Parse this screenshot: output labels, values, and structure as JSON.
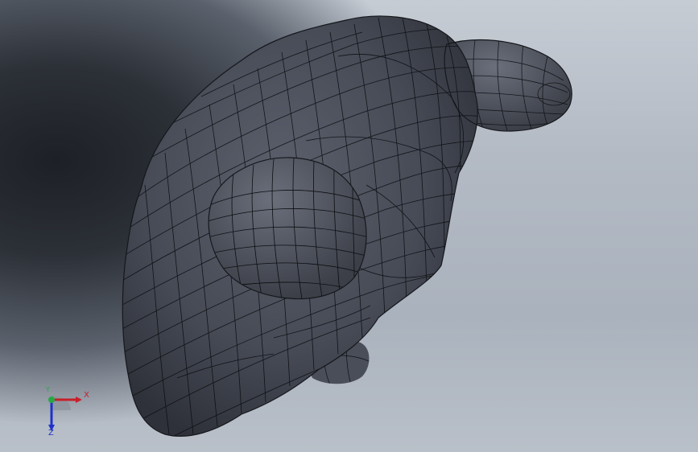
{
  "viewport": {
    "background_top": "#c6ccd4",
    "background_dark": "#1d2026",
    "model_color": "#4a4e59",
    "mesh_color": "#0d0e11"
  },
  "triad": {
    "x_label": "X",
    "y_label": "Y",
    "z_label": "Z",
    "x_color": "#c8202a",
    "y_color": "#27a845",
    "z_color": "#1f32c8"
  }
}
